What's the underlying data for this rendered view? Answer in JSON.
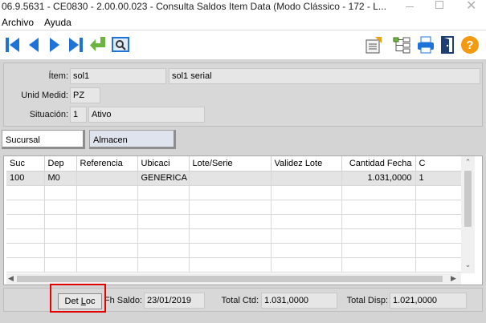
{
  "window": {
    "title": "06.9.5631 - CE0830 - 2.00.00.023 - Consulta Saldos Item Data (Modo Clássico - 172 - L..."
  },
  "menu": {
    "items": [
      "Archivo",
      "Ayuda"
    ]
  },
  "toolbar": {
    "left_icons": [
      "first-record-icon",
      "previous-record-icon",
      "next-record-icon",
      "last-record-icon",
      "return-icon",
      "search-icon"
    ],
    "right_icons": [
      "report-icon",
      "tree-structure-icon",
      "print-icon",
      "exit-door-icon",
      "help-icon"
    ]
  },
  "header": {
    "item_label": "Ítem:",
    "item_code": "sol1",
    "item_desc": "sol1 serial",
    "unit_label": "Unid Medid:",
    "unit_value": "PZ",
    "situation_label": "Situación:",
    "situation_code": "1",
    "situation_desc": "Ativo"
  },
  "tabs": [
    {
      "label": "Sucursal",
      "active": true
    },
    {
      "label": "Almacen",
      "active": false
    }
  ],
  "grid": {
    "columns": [
      "Suc",
      "Dep",
      "Referencia",
      "Ubicaci",
      "Lote/Serie",
      "Validez Lote",
      "Cantidad Fecha",
      "C"
    ],
    "rows": [
      [
        "100",
        "M0",
        "",
        "GENERICA",
        "",
        "",
        "1.031,0000",
        "1"
      ]
    ]
  },
  "footer": {
    "button_prefix": "Det ",
    "button_underlined": "L",
    "button_suffix": "oc",
    "fh_saldo_label": "Fh Saldo:",
    "fh_saldo_value": "23/01/2019",
    "total_ctd_label": "Total Ctd:",
    "total_ctd_value": "1.031,0000",
    "total_disp_label": "Total Disp:",
    "total_disp_value": "1.021,0000"
  },
  "colors": {
    "toolbar_blue": "#1e73d9",
    "toolbar_green": "#6db33f",
    "highlight_red": "#e30000"
  }
}
